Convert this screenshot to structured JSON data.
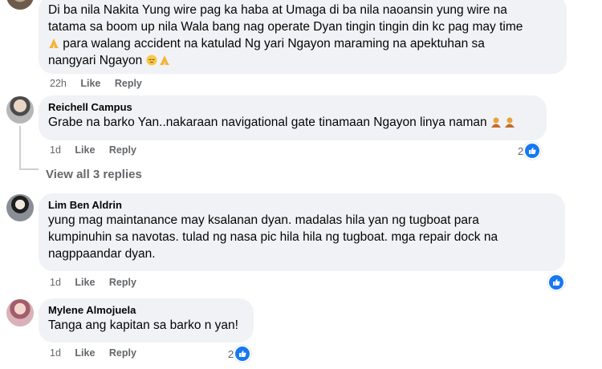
{
  "comments": [
    {
      "author": "",
      "text_line1": "Di ba nila Nakita Yung wire pag ka haba at Umaga di ba nila naoansin yung wire na",
      "text_line2": "tatama sa boom up nila Wala bang nag operate Dyan tingin tingin din kc pag may time",
      "text_line3": " para walang accident na katulad Ng yari Ngayon maraming na apektuhan sa",
      "text_line4": "nangyari Ngayon ",
      "time": "22h",
      "like": "Like",
      "reply": "Reply"
    },
    {
      "author": "Reichell Campus",
      "text_line1": "Grabe na barko Yan..nakaraan navigational gate tinamaan Ngayon linya naman ",
      "time": "1d",
      "like": "Like",
      "reply": "Reply",
      "reaction_count": "2"
    },
    {
      "author": "Lim Ben Aldrin",
      "text_line1": "yung mag maintanance may ksalanan dyan. madalas hila yan ng tugboat para",
      "text_line2": "kumpinuhin sa navotas. tulad ng nasa pic hila hila ng tugboat. mga repair dock na",
      "text_line3": "nagppaandar dyan.",
      "time": "1d",
      "like": "Like",
      "reply": "Reply"
    },
    {
      "author": "Mylene Almojuela",
      "text_line1": "Tanga ang kapitan sa barko n yan!",
      "time": "1d",
      "like": "Like",
      "reply": "Reply",
      "reaction_count": "2"
    }
  ],
  "view_replies": "View all 3 replies",
  "colors": {
    "bubble": "#f0f2f5",
    "meta": "#65676b",
    "like_blue": "#1877f2"
  },
  "icons": [
    "like-icon",
    "pray-emoji",
    "pensive-emoji",
    "person-emoji"
  ]
}
